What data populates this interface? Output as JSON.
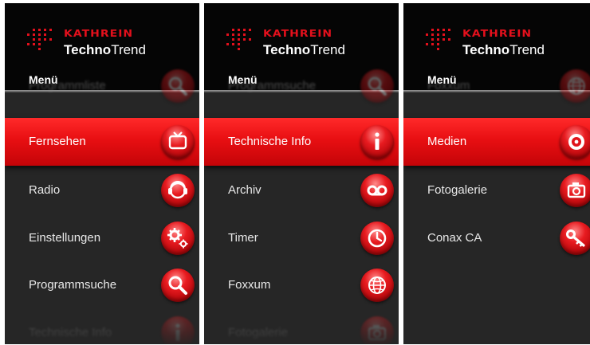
{
  "screens": [
    {
      "brand": {
        "top": "KATHREIN",
        "bottom_bold": "Techno",
        "bottom_light": "Trend"
      },
      "menu_title": "Menü",
      "items": [
        {
          "label": "Programmliste",
          "icon": "search-icon",
          "state": "faded"
        },
        {
          "label": "Fernsehen",
          "icon": "tv-icon",
          "state": "selected"
        },
        {
          "label": "Radio",
          "icon": "radio-icon",
          "state": "normal"
        },
        {
          "label": "Einstellungen",
          "icon": "settings-gears-icon",
          "state": "normal"
        },
        {
          "label": "Programmsuche",
          "icon": "search-icon",
          "state": "normal"
        },
        {
          "label": "Technische Info",
          "icon": "info-icon",
          "state": "faded"
        }
      ]
    },
    {
      "brand": {
        "top": "KATHREIN",
        "bottom_bold": "Techno",
        "bottom_light": "Trend"
      },
      "menu_title": "Menü",
      "items": [
        {
          "label": "Programmsuche",
          "icon": "search-icon",
          "state": "faded"
        },
        {
          "label": "Technische Info",
          "icon": "info-icon",
          "state": "selected"
        },
        {
          "label": "Archiv",
          "icon": "archive-tape-icon",
          "state": "normal"
        },
        {
          "label": "Timer",
          "icon": "clock-icon",
          "state": "normal"
        },
        {
          "label": "Foxxum",
          "icon": "globe-icon",
          "state": "normal"
        },
        {
          "label": "Fotogalerie",
          "icon": "camera-icon",
          "state": "faded"
        }
      ]
    },
    {
      "brand": {
        "top": "KATHREIN",
        "bottom_bold": "Techno",
        "bottom_light": "Trend"
      },
      "menu_title": "Menü",
      "items": [
        {
          "label": "Foxxum",
          "icon": "globe-icon",
          "state": "faded"
        },
        {
          "label": "Medien",
          "icon": "disc-icon",
          "state": "selected"
        },
        {
          "label": "Fotogalerie",
          "icon": "camera-icon",
          "state": "normal"
        },
        {
          "label": "Conax CA",
          "icon": "key-icon",
          "state": "normal"
        }
      ]
    }
  ],
  "colors": {
    "accent": "#e3101c",
    "background": "#262626",
    "header": "#050505"
  }
}
